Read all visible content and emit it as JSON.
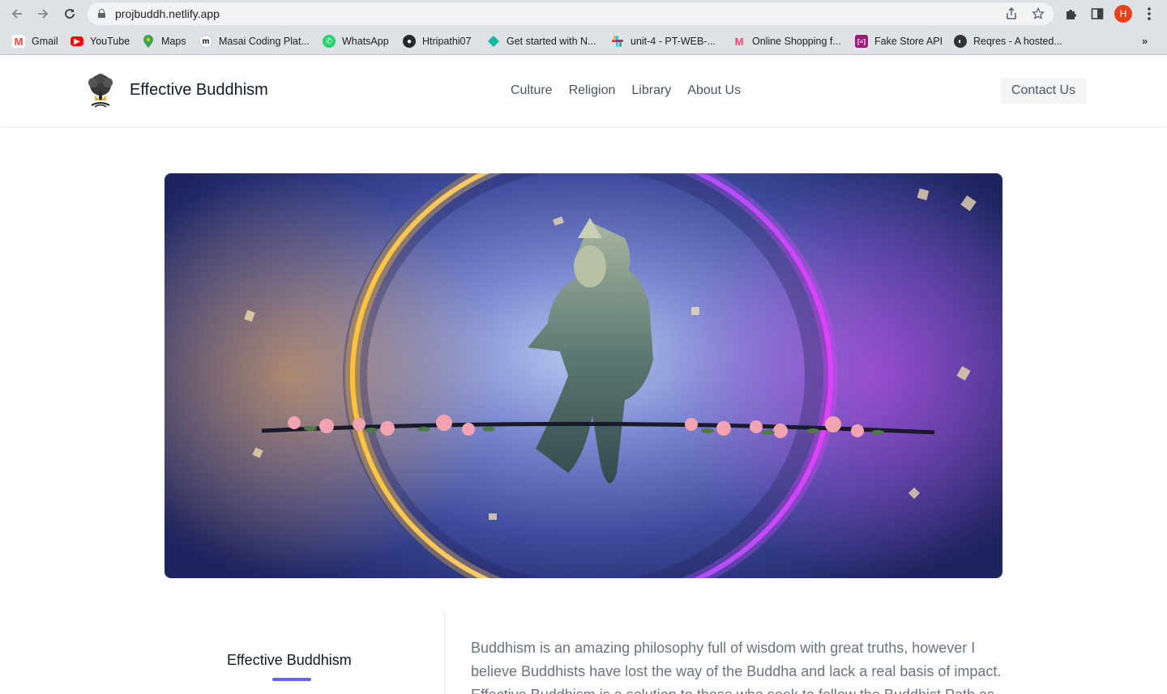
{
  "browser": {
    "url": "projbuddh.netlify.app",
    "profile_initial": "H",
    "bookmarks": [
      {
        "label": "Gmail",
        "icon": "gmail-icon"
      },
      {
        "label": "YouTube",
        "icon": "youtube-icon"
      },
      {
        "label": "Maps",
        "icon": "maps-icon"
      },
      {
        "label": "Masai Coding Plat...",
        "icon": "masai-icon"
      },
      {
        "label": "WhatsApp",
        "icon": "whatsapp-icon"
      },
      {
        "label": "Htripathi07",
        "icon": "github-icon"
      },
      {
        "label": "Get started with N...",
        "icon": "diamond-icon"
      },
      {
        "label": "unit-4 - PT-WEB-...",
        "icon": "slack-icon"
      },
      {
        "label": "Online Shopping f...",
        "icon": "myntra-icon"
      },
      {
        "label": "Fake Store API",
        "icon": "fakestore-icon"
      },
      {
        "label": "Reqres - A hosted...",
        "icon": "globe-icon"
      }
    ],
    "more_bookmarks": "»"
  },
  "site": {
    "brand": "Effective Buddhism",
    "nav": [
      "Culture",
      "Religion",
      "Library",
      "About Us"
    ],
    "contact_label": "Contact Us",
    "hero_image": "buddha-statue-image",
    "section": {
      "side_title": "Effective Buddhism",
      "intro": "Buddhism is an amazing philosophy full of wisdom with great truths, however I believe Buddhists have lost the way of the Buddha and lack a real basis of impact. Effective Buddhism is a solution to those who seek to follow the Buddhist Path as"
    }
  },
  "colors": {
    "accent": "#6366f1",
    "profile": "#e8401c"
  }
}
